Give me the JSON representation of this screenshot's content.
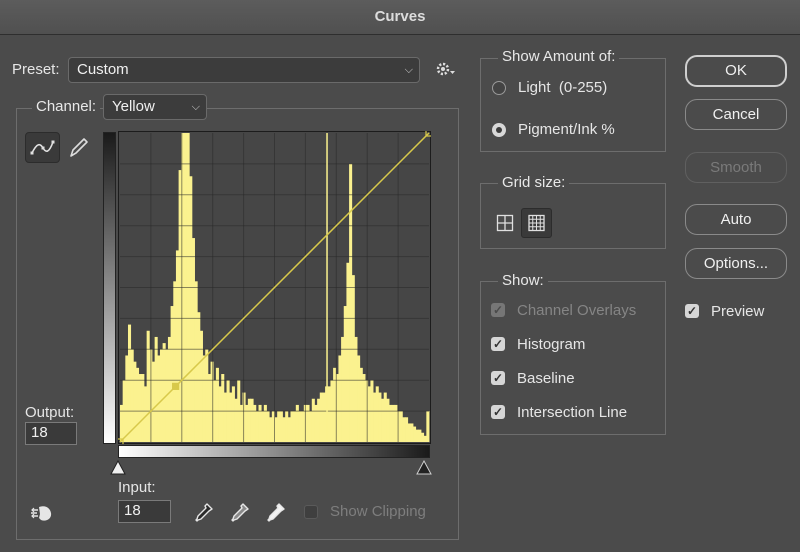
{
  "window": {
    "title": "Curves"
  },
  "preset": {
    "label": "Preset:",
    "value": "Custom"
  },
  "channel": {
    "label": "Channel:",
    "value": "Yellow"
  },
  "output": {
    "label": "Output:",
    "value": "18"
  },
  "input": {
    "label": "Input:",
    "value": "18"
  },
  "show_clipping": {
    "label": "Show Clipping",
    "checked": false
  },
  "show_amount": {
    "title": "Show Amount of:",
    "light_label": "Light  (0-255)",
    "pigment_label": "Pigment/Ink %",
    "selected": "Pigment/Ink %"
  },
  "grid_size": {
    "title": "Grid size:",
    "selected": "fine"
  },
  "show": {
    "title": "Show:",
    "channel_overlays": "Channel Overlays",
    "histogram": "Histogram",
    "baseline": "Baseline",
    "intersection_line": "Intersection Line"
  },
  "buttons": {
    "ok": "OK",
    "cancel": "Cancel",
    "smooth": "Smooth",
    "auto": "Auto",
    "options": "Options..."
  },
  "preview": {
    "label": "Preview",
    "checked": true
  },
  "colors": {
    "histogram": "#fbf28f",
    "curve": "#d8c94a",
    "dialog_bg": "#4b4b4b",
    "graph_bg": "#464646"
  },
  "curve": {
    "points": [
      [
        0,
        0
      ],
      [
        18,
        18
      ],
      [
        100,
        100
      ]
    ],
    "intersection_input": 67
  },
  "histogram": [
    12,
    20,
    28,
    38,
    30,
    26,
    24,
    22,
    22,
    18,
    36,
    30,
    26,
    34,
    28,
    30,
    32,
    30,
    34,
    44,
    52,
    62,
    88,
    100,
    100,
    100,
    86,
    66,
    52,
    42,
    36,
    28,
    30,
    22,
    26,
    20,
    24,
    18,
    22,
    16,
    20,
    16,
    18,
    14,
    20,
    12,
    16,
    12,
    14,
    14,
    12,
    10,
    12,
    10,
    12,
    10,
    8,
    10,
    8,
    10,
    10,
    8,
    10,
    8,
    10,
    10,
    12,
    10,
    10,
    12,
    12,
    10,
    14,
    12,
    14,
    16,
    16,
    18,
    18,
    20,
    24,
    22,
    28,
    34,
    44,
    58,
    90,
    54,
    34,
    28,
    24,
    22,
    20,
    18,
    20,
    16,
    18,
    16,
    14,
    16,
    14,
    12,
    12,
    12,
    10,
    10,
    8,
    8,
    6,
    6,
    5,
    4,
    4,
    3,
    2,
    10
  ]
}
